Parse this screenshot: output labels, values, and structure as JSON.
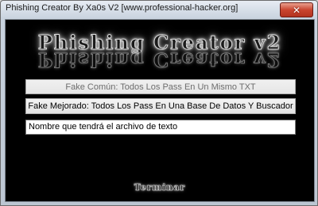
{
  "window": {
    "title": "Phishing Creator By Xa0s V2 [www.professional-hacker.org]",
    "close_glyph": "✕"
  },
  "logo": {
    "text": "Phishing Creator v2"
  },
  "buttons": {
    "fake_comun": "Fake Común: Todos Los Pass En Un Mismo TXT",
    "fake_mejorado": "Fake Mejorado: Todos Los Pass En Una Base De Datos Y Buscador",
    "terminar": "Terminar"
  },
  "filename_input": {
    "value": "Nombre que tendrá el archivo de texto"
  },
  "colors": {
    "client_background": "#000000",
    "close_button": "#c9442f",
    "titlebar": "#c9d3df"
  },
  "icons": {
    "close": "close-icon"
  }
}
